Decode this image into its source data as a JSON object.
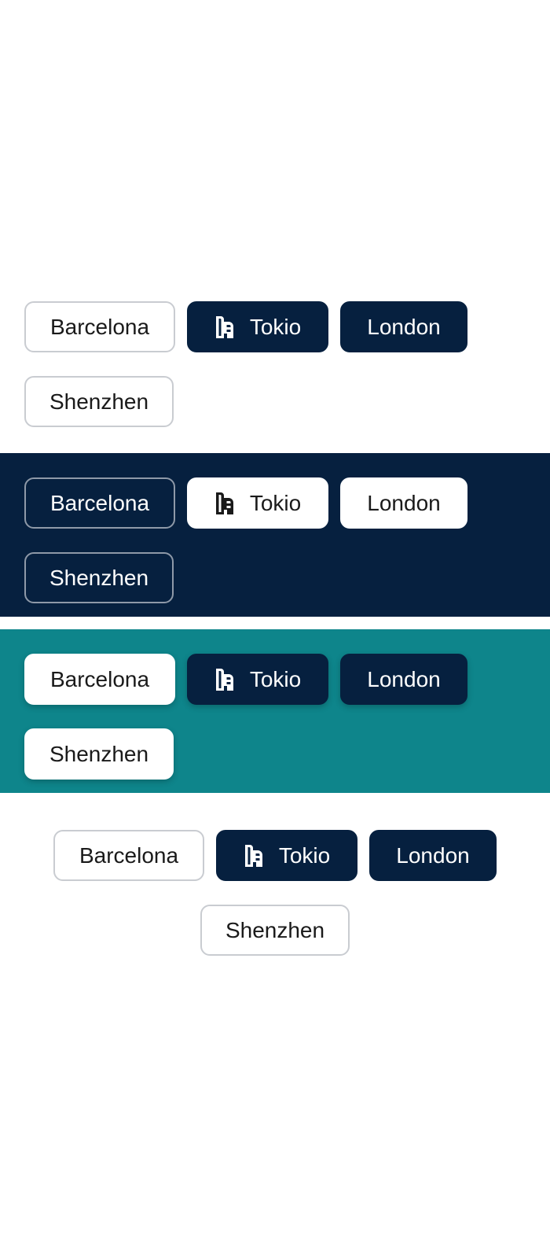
{
  "colors": {
    "navy": "#06203f",
    "teal": "#0e858b",
    "white": "#ffffff",
    "border_gray": "#c9ccd1"
  },
  "groups": [
    {
      "variant": "light-background",
      "chips": [
        {
          "label": "Barcelona"
        },
        {
          "label": "Tokio",
          "icon": "building-icon",
          "selected": true
        },
        {
          "label": "London",
          "selected": true
        },
        {
          "label": "Shenzhen"
        }
      ]
    },
    {
      "variant": "navy-background",
      "chips": [
        {
          "label": "Barcelona"
        },
        {
          "label": "Tokio",
          "icon": "building-icon",
          "selected": true
        },
        {
          "label": "London",
          "selected": true
        },
        {
          "label": "Shenzhen"
        }
      ]
    },
    {
      "variant": "teal-background",
      "chips": [
        {
          "label": "Barcelona"
        },
        {
          "label": "Tokio",
          "icon": "building-icon",
          "selected": true
        },
        {
          "label": "London",
          "selected": true
        },
        {
          "label": "Shenzhen"
        }
      ]
    },
    {
      "variant": "light-background-centered",
      "chips": [
        {
          "label": "Barcelona"
        },
        {
          "label": "Tokio",
          "icon": "building-icon",
          "selected": true
        },
        {
          "label": "London",
          "selected": true
        },
        {
          "label": "Shenzhen"
        }
      ]
    }
  ]
}
